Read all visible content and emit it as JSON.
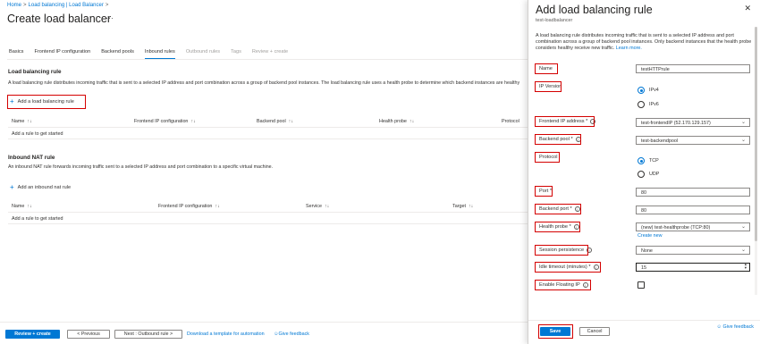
{
  "breadcrumb": {
    "home": "Home",
    "parent": "Load balancing | Load Balancer"
  },
  "page": {
    "title": "Create load balancer",
    "more": "···"
  },
  "tabs": [
    "Basics",
    "Frontend IP configuration",
    "Backend pools",
    "Inbound rules",
    "Outbound rules",
    "Tags",
    "Review + create"
  ],
  "active_tab": "Inbound rules",
  "lb_rules": {
    "title": "Load balancing rule",
    "desc": "A load balancing rule distributes incoming traffic that is sent to a selected IP address and port combination across a group of backend pool instances. The load balancing rule uses a health probe to determine which backend instances are healthy",
    "add_label": "Add a load balancing rule",
    "columns": [
      "Name",
      "Frontend IP configuration",
      "Backend pool",
      "Health probe",
      "Protocol"
    ],
    "empty": "Add a rule to get started"
  },
  "nat_rules": {
    "title": "Inbound NAT rule",
    "desc": "An inbound NAT rule forwards incoming traffic sent to a selected IP address and port combination to a specific virtual machine.",
    "add_label": "Add an inbound nat rule",
    "columns": [
      "Name",
      "Frontend IP configuration",
      "Service",
      "Target"
    ],
    "empty": "Add a rule to get started"
  },
  "footer": {
    "review_create": "Review + create",
    "previous": "< Previous",
    "next": "Next : Outbound rule >",
    "download": "Download a template for automation",
    "feedback": "Give feedback"
  },
  "panel": {
    "title": "Add load balancing rule",
    "subtitle": "test-loadbalancer",
    "desc": "A load balancing rule distributes incoming traffic that is sent to a selected IP address and port combination across a group of backend pool instances. Only backend instances that the health probe considers healthy receive new traffic.",
    "learn_more": "Learn more.",
    "labels": {
      "name": "Name",
      "ip_version": "IP Version",
      "frontend_ip": "Frontend IP address *",
      "backend_pool": "Backend pool *",
      "protocol": "Protocol",
      "port": "Port *",
      "backend_port": "Backend port *",
      "health_probe": "Health probe *",
      "session_persistence": "Session persistence",
      "idle_timeout": "Idle timeout (minutes) *",
      "floating_ip": "Enable Floating IP"
    },
    "values": {
      "name": "testHTTPrule",
      "ipv4": "IPv4",
      "ipv6": "IPv6",
      "frontend_ip": "test-frontendIP (52.170.129.157)",
      "backend_pool": "test-backendpool",
      "tcp": "TCP",
      "udp": "UDP",
      "port": "80",
      "backend_port": "80",
      "health_probe": "(new) test-healthprobe (TCP:80)",
      "create_new": "Create new",
      "session_persistence": "None",
      "idle_timeout": "15"
    },
    "selected_ip_version": "IPv4",
    "selected_protocol": "TCP",
    "floating_ip_checked": false,
    "save": "Save",
    "cancel": "Cancel",
    "feedback": "Give feedback"
  },
  "colors": {
    "accent": "#0078d4",
    "highlight": "#d40000"
  }
}
